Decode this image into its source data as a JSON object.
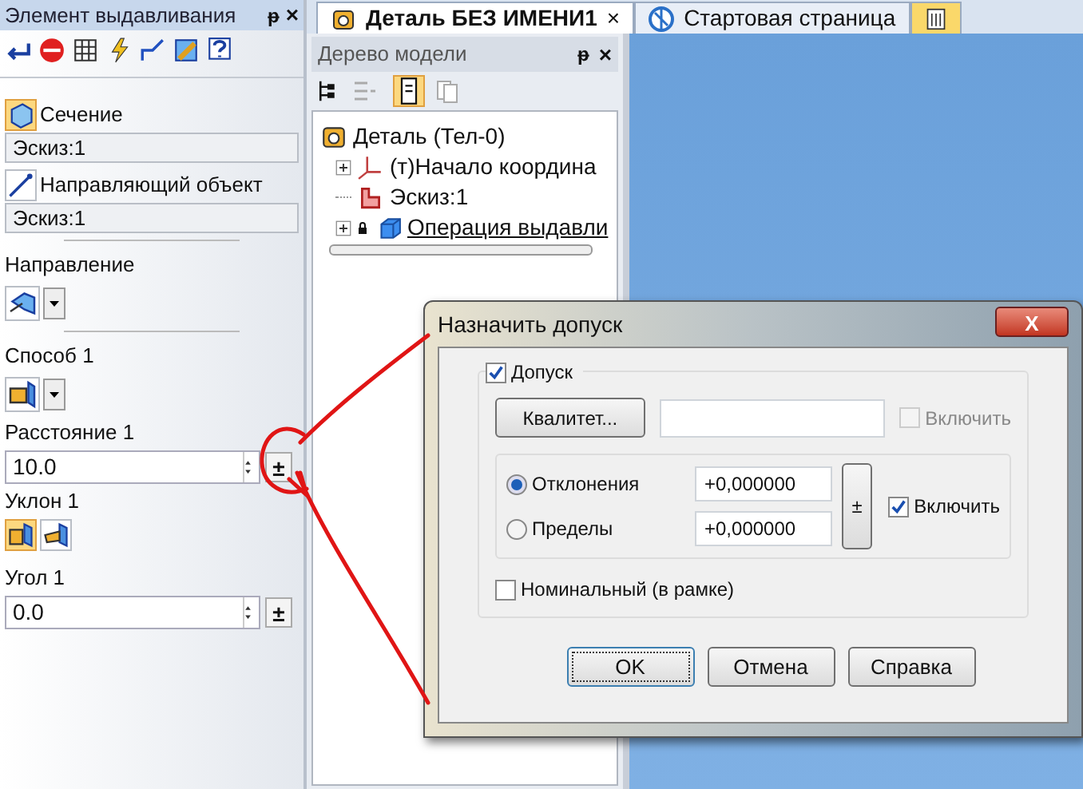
{
  "left_panel": {
    "title": "Элемент выдавливания",
    "pin": "ᵽ",
    "close": "×",
    "section": {
      "label": "Сечение",
      "value": "Эскиз:1"
    },
    "guide_object": {
      "label": "Направляющий объект",
      "value": "Эскиз:1"
    },
    "direction": {
      "label": "Направление"
    },
    "method": {
      "label": "Способ 1"
    },
    "distance": {
      "label": "Расстояние 1",
      "value": "10.0",
      "tolerance_button": "±"
    },
    "draft": {
      "label": "Уклон 1",
      "options": [
        {
          "selected": true
        },
        {
          "selected": false
        }
      ]
    },
    "angle": {
      "label": "Угол 1",
      "value": "0.0",
      "tolerance_button": "±"
    }
  },
  "tabs": [
    {
      "kind": "document",
      "label": "Деталь БЕЗ ИМЕНИ1",
      "selected": true,
      "close": "×"
    },
    {
      "kind": "start",
      "label": "Стартовая страница",
      "selected": false
    },
    {
      "kind": "icon",
      "selected": false
    }
  ],
  "tree_panel": {
    "title": "Дерево модели",
    "pin": "ᵽ",
    "close": "×",
    "tree": [
      {
        "kind": "part",
        "label": "Деталь (Тел-0)",
        "children": [
          {
            "kind": "axes",
            "label": "(т)Начало координа",
            "expanded": false
          },
          {
            "kind": "sketch",
            "label": "Эскиз:1"
          },
          {
            "kind": "extrusion",
            "label": "Операция выдавли",
            "expanded": false
          }
        ]
      }
    ]
  },
  "dialog": {
    "title": "Назначить допуск",
    "close": "X",
    "tolerance": {
      "label": "Допуск",
      "checked": true
    },
    "grade_button": "Квалитет...",
    "grade_enable": {
      "label": "Включить",
      "checked": false,
      "disabled": true
    },
    "modes": [
      {
        "label": "Отклонения",
        "selected": true,
        "value": "+0,000000"
      },
      {
        "label": "Пределы",
        "selected": false,
        "value": "+0,000000"
      }
    ],
    "plus_minus": "±",
    "enable": {
      "label": "Включить",
      "checked": true
    },
    "nominal": {
      "label": "Номинальный (в рамке)",
      "checked": false
    },
    "buttons": [
      {
        "label": "OK",
        "default": true
      },
      {
        "label": "Отмена",
        "default": false
      },
      {
        "label": "Справка",
        "default": false
      }
    ]
  }
}
